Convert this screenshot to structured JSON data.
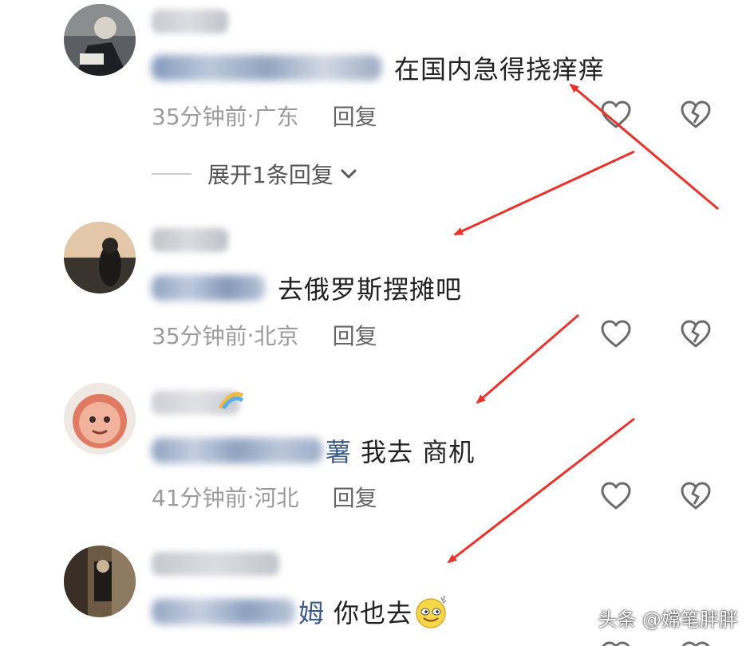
{
  "comments": [
    {
      "mention_tail": "",
      "text": "在国内急得挠痒痒",
      "time": "35分钟前",
      "location": "广东",
      "reply_label": "回复"
    },
    {
      "mention_tail": "",
      "text": "去俄罗斯摆摊吧",
      "time": "35分钟前",
      "location": "北京",
      "reply_label": "回复"
    },
    {
      "mention_tail": "薯",
      "text": "我去 商机",
      "time": "41分钟前",
      "location": "河北",
      "reply_label": "回复"
    },
    {
      "mention_tail": "姆",
      "text": "你也去",
      "emoji": "smiling-face-emoji"
    }
  ],
  "expand_replies_label": "展开1条回复",
  "meta_separator": " · ",
  "watermark": "头条 @嫦笔胖胖",
  "colors": {
    "mention": "#3d5b86",
    "meta": "#9b9b9b",
    "annotation_arrow": "#e8332b"
  },
  "icons": {
    "like": "heart-outline-icon",
    "dislike": "broken-heart-icon",
    "expand": "chevron-down-icon"
  }
}
